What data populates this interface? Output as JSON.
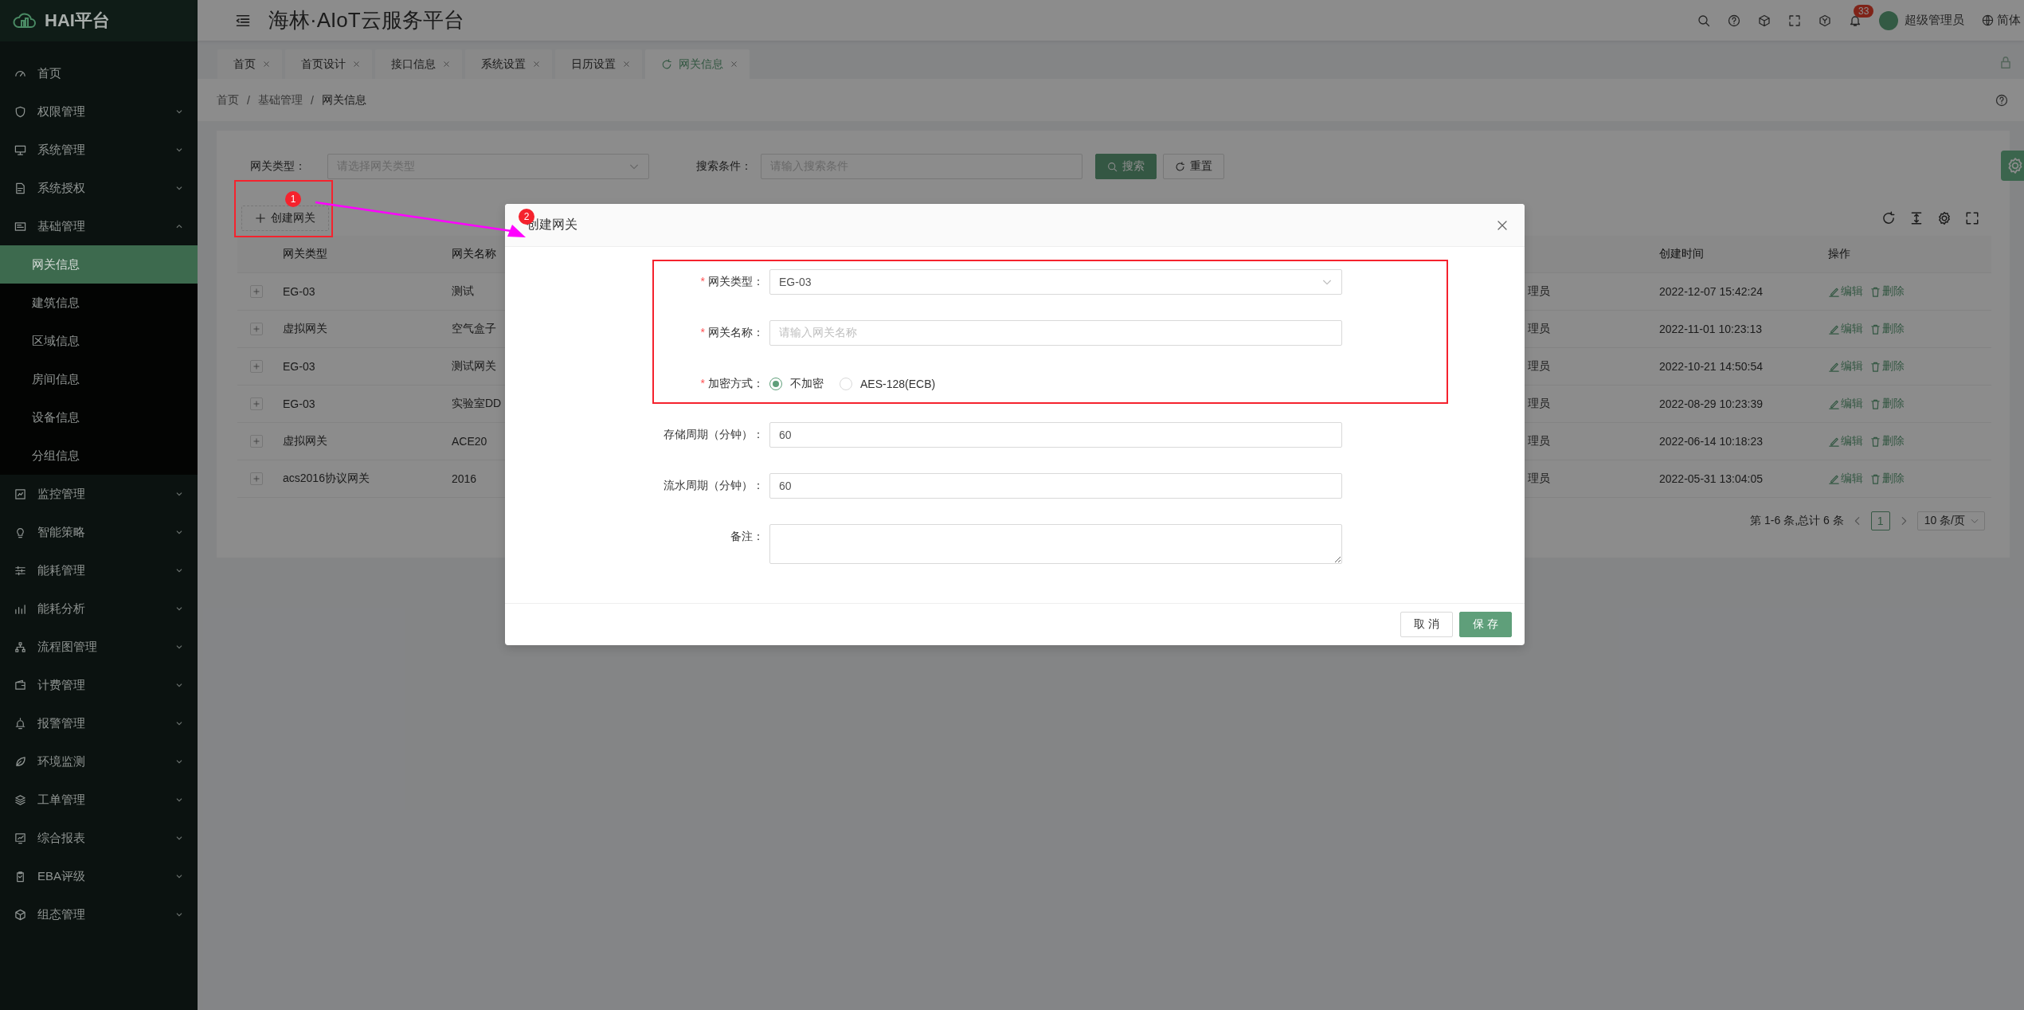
{
  "sidebar": {
    "logo": "HAI平台",
    "items": [
      {
        "kind": "link",
        "label": "首页"
      },
      {
        "kind": "group",
        "label": "权限管理",
        "expanded": false
      },
      {
        "kind": "group",
        "label": "系统管理",
        "expanded": false
      },
      {
        "kind": "group",
        "label": "系统授权",
        "expanded": false
      },
      {
        "kind": "group",
        "label": "基础管理",
        "expanded": true,
        "children": [
          {
            "label": "网关信息",
            "selected": true
          },
          {
            "label": "建筑信息",
            "selected": false
          },
          {
            "label": "区域信息",
            "selected": false
          },
          {
            "label": "房间信息",
            "selected": false
          },
          {
            "label": "设备信息",
            "selected": false
          },
          {
            "label": "分组信息",
            "selected": false
          }
        ]
      },
      {
        "kind": "group",
        "label": "监控管理",
        "expanded": false
      },
      {
        "kind": "group",
        "label": "智能策略",
        "expanded": false
      },
      {
        "kind": "group",
        "label": "能耗管理",
        "expanded": false
      },
      {
        "kind": "group",
        "label": "能耗分析",
        "expanded": false
      },
      {
        "kind": "group",
        "label": "流程图管理",
        "expanded": false
      },
      {
        "kind": "group",
        "label": "计费管理",
        "expanded": false
      },
      {
        "kind": "group",
        "label": "报警管理",
        "expanded": false
      },
      {
        "kind": "group",
        "label": "环境监测",
        "expanded": false
      },
      {
        "kind": "group",
        "label": "工单管理",
        "expanded": false
      },
      {
        "kind": "group",
        "label": "综合报表",
        "expanded": false
      },
      {
        "kind": "group",
        "label": "EBA评级",
        "expanded": false
      },
      {
        "kind": "group",
        "label": "组态管理",
        "expanded": false
      }
    ]
  },
  "header": {
    "title": "海林·AIoT云服务平台",
    "notification_count": "33",
    "user": "超级管理员",
    "language": "简体"
  },
  "tabs": [
    {
      "label": "首页",
      "selected": false
    },
    {
      "label": "首页设计",
      "selected": false
    },
    {
      "label": "接口信息",
      "selected": false
    },
    {
      "label": "系统设置",
      "selected": false
    },
    {
      "label": "日历设置",
      "selected": false
    },
    {
      "label": "网关信息",
      "selected": true
    }
  ],
  "breadcrumb": {
    "separator": "/",
    "items": [
      "首页",
      "基础管理",
      "网关信息"
    ]
  },
  "search": {
    "fields": [
      {
        "kind": "select",
        "label": "网关类型：",
        "placeholder": "请选择网关类型"
      },
      {
        "kind": "input",
        "label": "搜索条件：",
        "placeholder": "请输入搜索条件"
      }
    ],
    "search_button": "搜索",
    "reset_button": "重置"
  },
  "create_button": "创建网关",
  "table": {
    "headers": {
      "type": "网关类型",
      "name": "网关名称",
      "created": "创建时间",
      "actions": "操作"
    },
    "rows": [
      {
        "type": "EG-03",
        "name": "测试",
        "column_3": "理员",
        "created": "2022-12-07 15:42:24",
        "edit": "编辑",
        "delete": "删除"
      },
      {
        "type": "虚拟网关",
        "name": "空气盒子",
        "column_3": "理员",
        "created": "2022-11-01 10:23:13",
        "edit": "编辑",
        "delete": "删除"
      },
      {
        "type": "EG-03",
        "name": "测试网关",
        "column_3": "理员",
        "created": "2022-10-21 14:50:54",
        "edit": "编辑",
        "delete": "删除"
      },
      {
        "type": "EG-03",
        "name": "实验室DD",
        "column_3": "理员",
        "created": "2022-08-29 10:23:39",
        "edit": "编辑",
        "delete": "删除"
      },
      {
        "type": "虚拟网关",
        "name": "ACE20",
        "column_3": "理员",
        "created": "2022-06-14 10:18:23",
        "edit": "编辑",
        "delete": "删除"
      },
      {
        "type": "acs2016协议网关",
        "name": "2016",
        "column_3": "理员",
        "created": "2022-05-31 13:04:05",
        "edit": "编辑",
        "delete": "删除"
      }
    ]
  },
  "pagination": {
    "summary": "第 1-6 条,总计 6 条",
    "pages": [
      {
        "label": "1",
        "selected": true
      }
    ],
    "page_size": "10 条/页"
  },
  "dialog": {
    "title": "创建网关",
    "required_mark": "*",
    "fields": [
      {
        "kind": "select",
        "label": "网关类型：",
        "required": true,
        "value": "EG-03"
      },
      {
        "kind": "input",
        "label": "网关名称：",
        "required": true,
        "placeholder": "请输入网关名称"
      },
      {
        "kind": "radio",
        "label": "加密方式：",
        "required": true,
        "options": [
          {
            "label": "不加密",
            "selected": true
          },
          {
            "label": "AES-128(ECB)",
            "selected": false
          }
        ]
      },
      {
        "kind": "input",
        "label": "存储周期（分钟）：",
        "required": false,
        "value": "60"
      },
      {
        "kind": "input",
        "label": "流水周期（分钟）：",
        "required": false,
        "value": "60"
      },
      {
        "kind": "textarea",
        "label": "备注：",
        "required": false
      }
    ],
    "buttons": [
      {
        "kind": "default",
        "label": "取 消"
      },
      {
        "kind": "primary",
        "label": "保 存"
      }
    ]
  },
  "annotations": [
    {
      "label": "1"
    },
    {
      "label": "2"
    }
  ]
}
